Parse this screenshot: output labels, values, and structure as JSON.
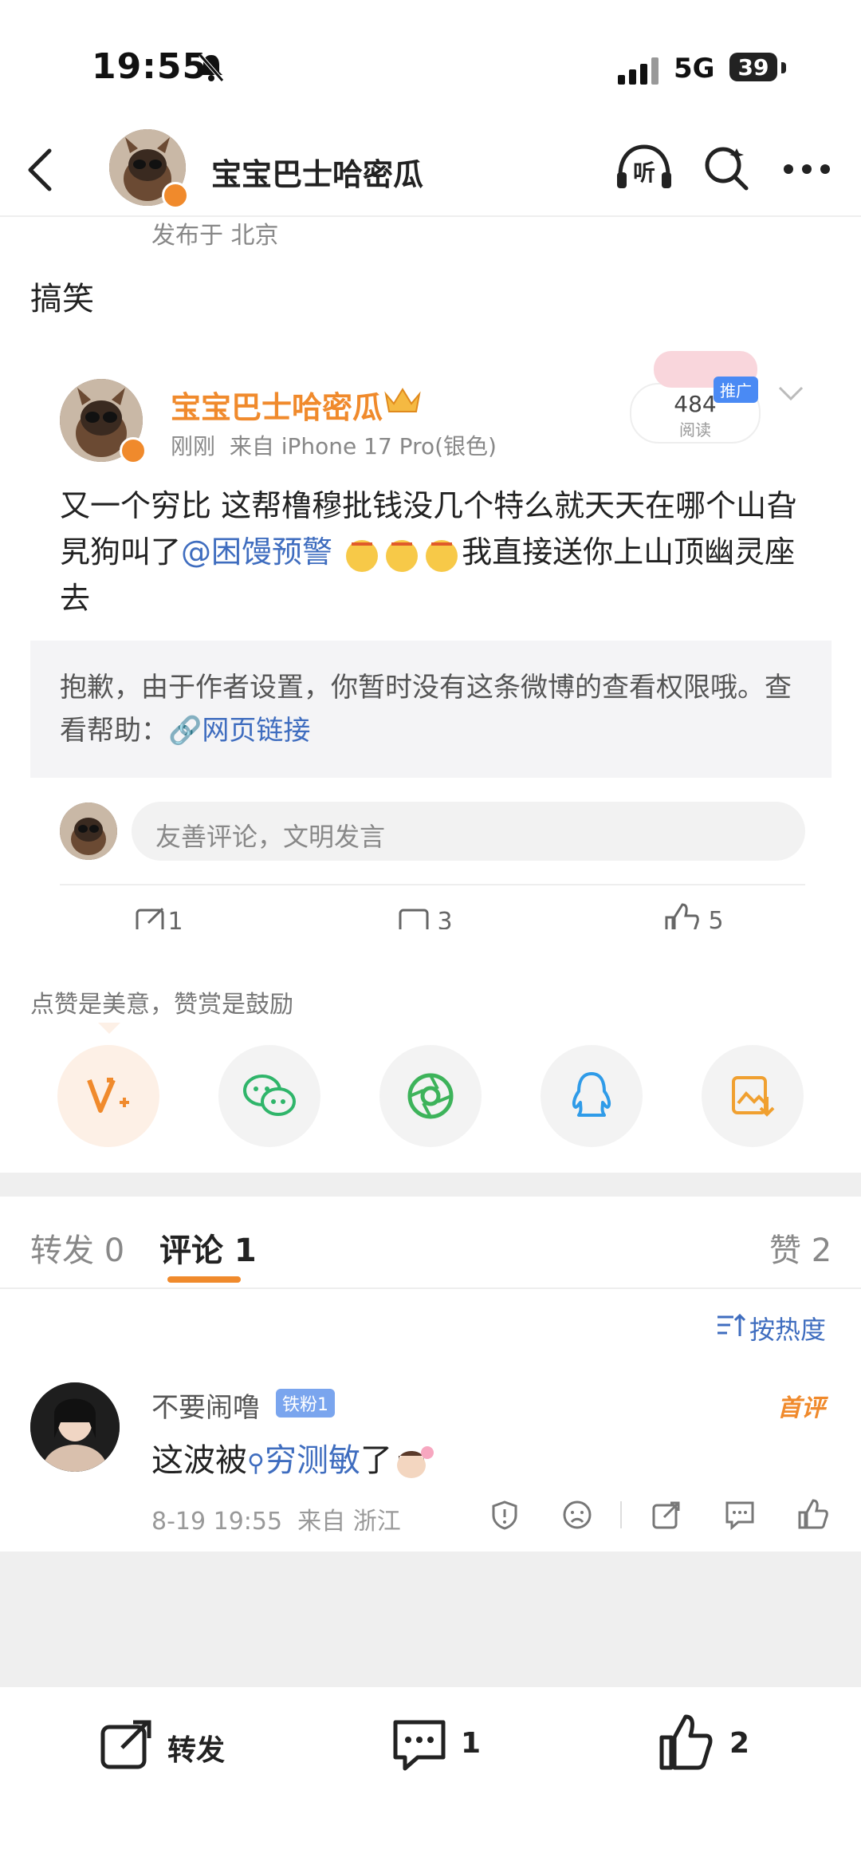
{
  "status_bar": {
    "time": "19:55",
    "network": "5G",
    "battery": "39"
  },
  "header": {
    "author_name": "宝宝巴士哈密瓜",
    "location_line": "发布于 北京"
  },
  "post": {
    "text": "搞笑"
  },
  "embedded_card": {
    "author_name": "宝宝巴士哈密瓜",
    "time": "刚刚",
    "source": "来自 iPhone 17 Pro(银色)",
    "read_count": "484",
    "read_label": "阅读",
    "promo_badge": "推广",
    "body_pre": "又一个穷比 这帮橹穆批钱没几个特么就天天在哪个山旮旯狗叫了",
    "mention": "@困馒预警",
    "body_post": "我直接送你上山顶幽灵座去",
    "restricted_text": "抱歉，由于作者设置，你暂时没有这条微博的查看权限哦。查看帮助：",
    "link_label": "网页链接",
    "comment_placeholder": "友善评论，文明发言",
    "repost_count": "1",
    "comment_count": "3",
    "like_count": "5"
  },
  "praise_note": "点赞是美意，赞赏是鼓励",
  "tabs": {
    "repost": "转发 0",
    "comment": "评论 1",
    "like": "赞 2"
  },
  "sort_label": "按热度",
  "comment": {
    "user": "不要闹噜",
    "badge": "铁粉1",
    "first_tag": "首评",
    "text_pre": "这波被",
    "search_term": "穷测敏",
    "text_post": "了",
    "date": "8-19 19:55",
    "location": "来自 浙江"
  },
  "bottom_bar": {
    "repost_label": "转发",
    "comment_count": "1",
    "like_count": "2"
  }
}
